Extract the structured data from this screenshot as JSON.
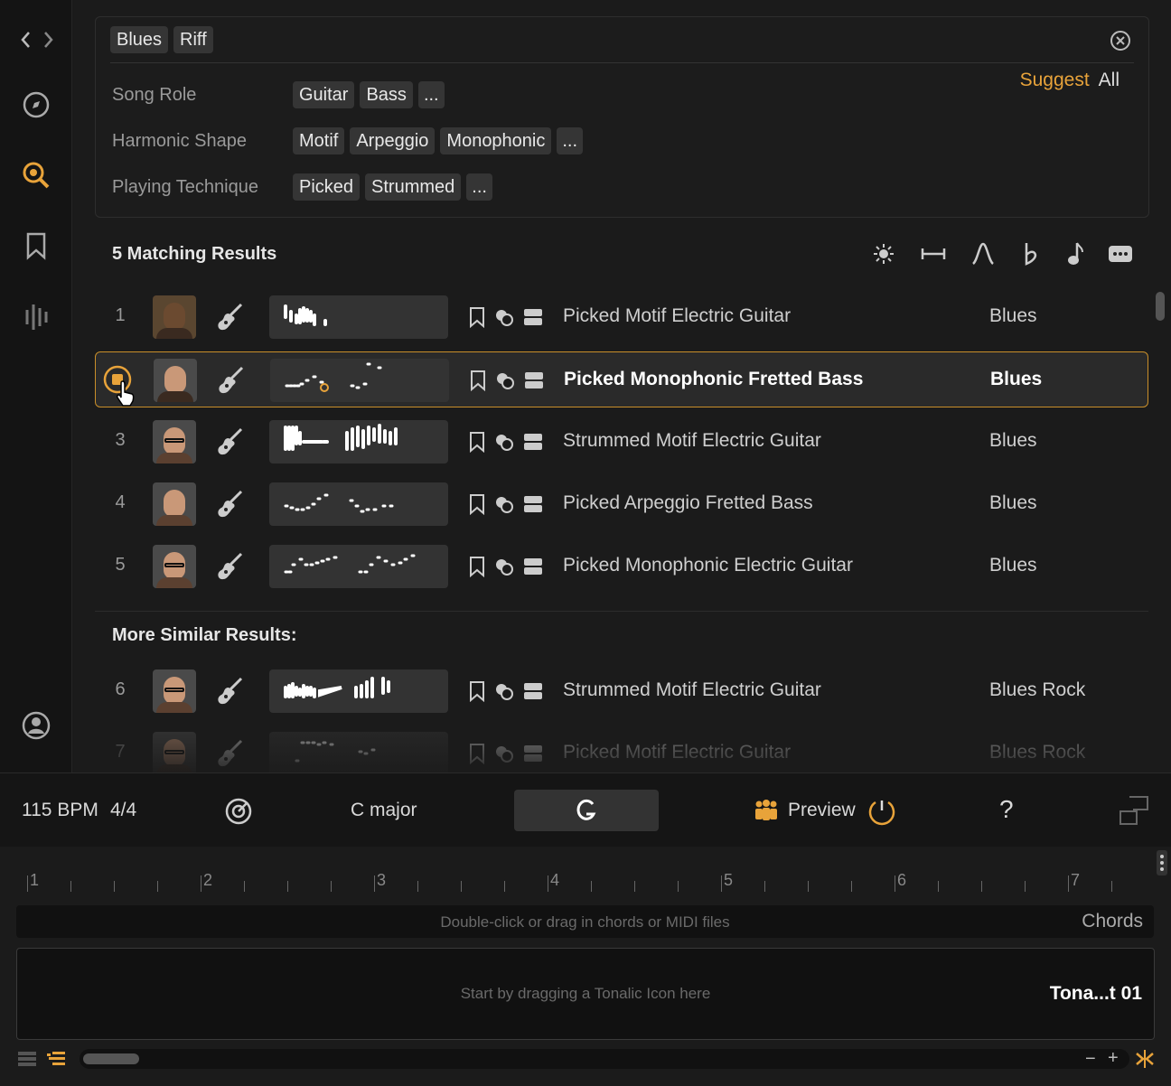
{
  "search": {
    "tags": [
      "Blues",
      "Riff"
    ],
    "suggest_label": "Suggest",
    "all_label": "All",
    "facets": [
      {
        "label": "Song Role",
        "chips": [
          "Guitar",
          "Bass"
        ],
        "more": "..."
      },
      {
        "label": "Harmonic Shape",
        "chips": [
          "Motif",
          "Arpeggio",
          "Monophonic"
        ],
        "more": "..."
      },
      {
        "label": "Playing Technique",
        "chips": [
          "Picked",
          "Strummed"
        ],
        "more": "..."
      }
    ]
  },
  "results": {
    "heading": "5 Matching Results",
    "more_heading": "More Similar Results:",
    "rows": [
      {
        "num": "1",
        "title": "Picked Motif Electric Guitar",
        "genre": "Blues"
      },
      {
        "num": "2",
        "title": "Picked Monophonic Fretted Bass",
        "genre": "Blues"
      },
      {
        "num": "3",
        "title": "Strummed Motif Electric Guitar",
        "genre": "Blues"
      },
      {
        "num": "4",
        "title": "Picked Arpeggio Fretted Bass",
        "genre": "Blues"
      },
      {
        "num": "5",
        "title": "Picked Monophonic Electric Guitar",
        "genre": "Blues"
      },
      {
        "num": "6",
        "title": "Strummed Motif Electric Guitar",
        "genre": "Blues Rock"
      },
      {
        "num": "7",
        "title": "Picked Motif Electric Guitar",
        "genre": "Blues Rock"
      }
    ]
  },
  "toolbar": {
    "tempo": "115 BPM",
    "meter": "4/4",
    "key": "C major",
    "preview_label": "Preview",
    "help": "?"
  },
  "timeline": {
    "bars": [
      "1",
      "2",
      "3",
      "4",
      "5",
      "6",
      "7"
    ],
    "chords_hint": "Double-click or drag in chords or MIDI files",
    "chords_label": "Chords",
    "track_hint": "Start by dragging a Tonalic Icon here",
    "track_label": "Tona...t 01",
    "zoom_out": "−",
    "zoom_in": "+"
  },
  "colors": {
    "accent": "#e8a33a",
    "selected_border": "#c98f2a"
  }
}
